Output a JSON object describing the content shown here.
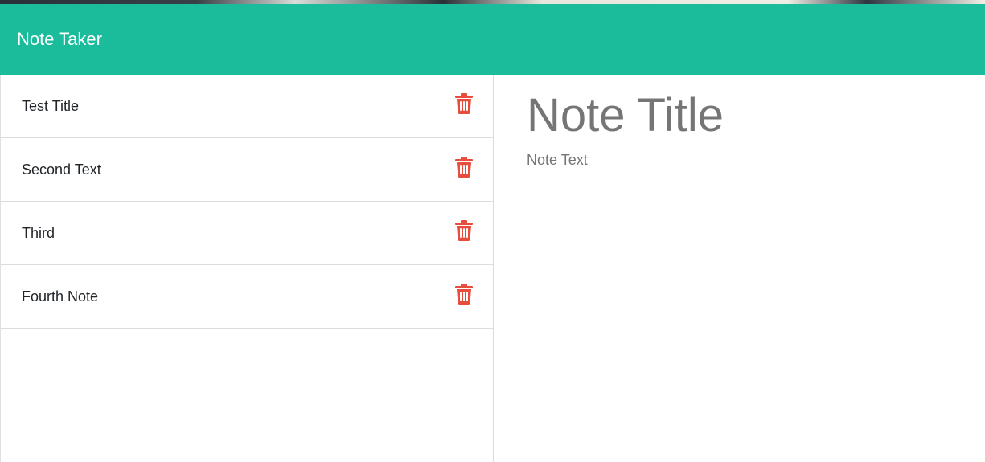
{
  "navbar": {
    "brand": "Note Taker"
  },
  "notes": [
    {
      "title": "Test Title"
    },
    {
      "title": "Second Text"
    },
    {
      "title": "Third"
    },
    {
      "title": "Fourth Note"
    }
  ],
  "editor": {
    "title_placeholder": "Note Title",
    "text_placeholder": "Note Text"
  },
  "colors": {
    "navbar": "#1abc9c",
    "delete_icon": "#e74c3c",
    "placeholder_text": "#757575"
  },
  "icons": {
    "delete": "trash-icon"
  }
}
